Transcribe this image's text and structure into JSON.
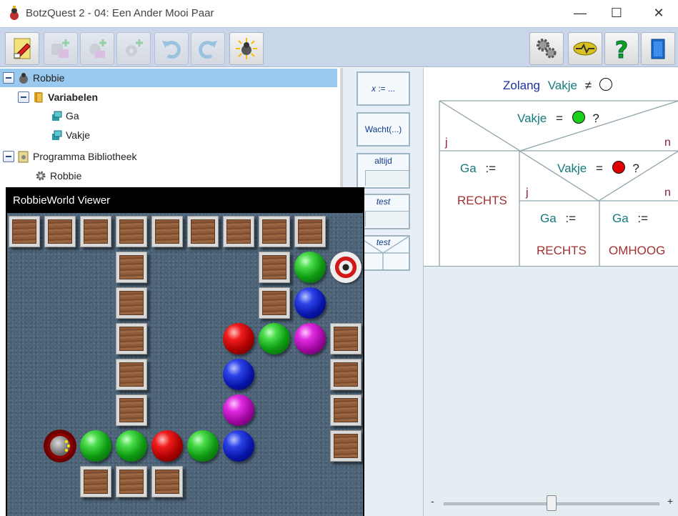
{
  "window": {
    "title": "BotzQuest 2 - 04: Een Ander Mooi Paar",
    "minimize": "—",
    "maximize": "☐",
    "close": "✕"
  },
  "toolbar": {
    "left_buttons": [
      "new-program-icon",
      "add-robot-icon",
      "add-procedure-icon",
      "add-function-icon",
      "undo-icon",
      "redo-icon",
      "run-icon"
    ],
    "right_buttons": [
      "settings-icon",
      "robot-library-icon",
      "help-icon",
      "exit-icon"
    ]
  },
  "tree": {
    "items": [
      {
        "label": "Robbie",
        "bold": false
      },
      {
        "label": "Variabelen",
        "bold": true
      },
      {
        "label": "Ga",
        "bold": false
      },
      {
        "label": "Vakje",
        "bold": false
      },
      {
        "label": "Programma Bibliotheek",
        "bold": false
      },
      {
        "label": "Robbie",
        "bold": false
      }
    ]
  },
  "palette": {
    "assign_x": "x",
    "assign_rest": ":= ...",
    "wait": "Wacht(...)",
    "always": "altijd",
    "test_loop": "test",
    "test_if": "test"
  },
  "program": {
    "loop_keyword": "Zolang",
    "loop_var": "Vakje",
    "loop_op": "≠",
    "cond1_var": "Vakje",
    "cond1_op": "=",
    "cond1_q": "?",
    "cond2_var": "Vakje",
    "cond2_op": "=",
    "cond2_q": "?",
    "yes": "j",
    "no": "n",
    "assign1_var": "Ga",
    "assign1_op": ":=",
    "assign1_val": "RECHTS",
    "assign2_var": "Ga",
    "assign2_op": ":=",
    "assign2_val": "RECHTS",
    "assign3_var": "Ga",
    "assign3_op": ":=",
    "assign3_val": "OMHOOG",
    "colors": {
      "green": "#1bd21b",
      "red": "#e00000",
      "white": "#ffffff"
    }
  },
  "zoom": {
    "minus": "-",
    "plus": "+",
    "level": 0.5
  },
  "viewer": {
    "title": "RobbieWorld Viewer"
  }
}
